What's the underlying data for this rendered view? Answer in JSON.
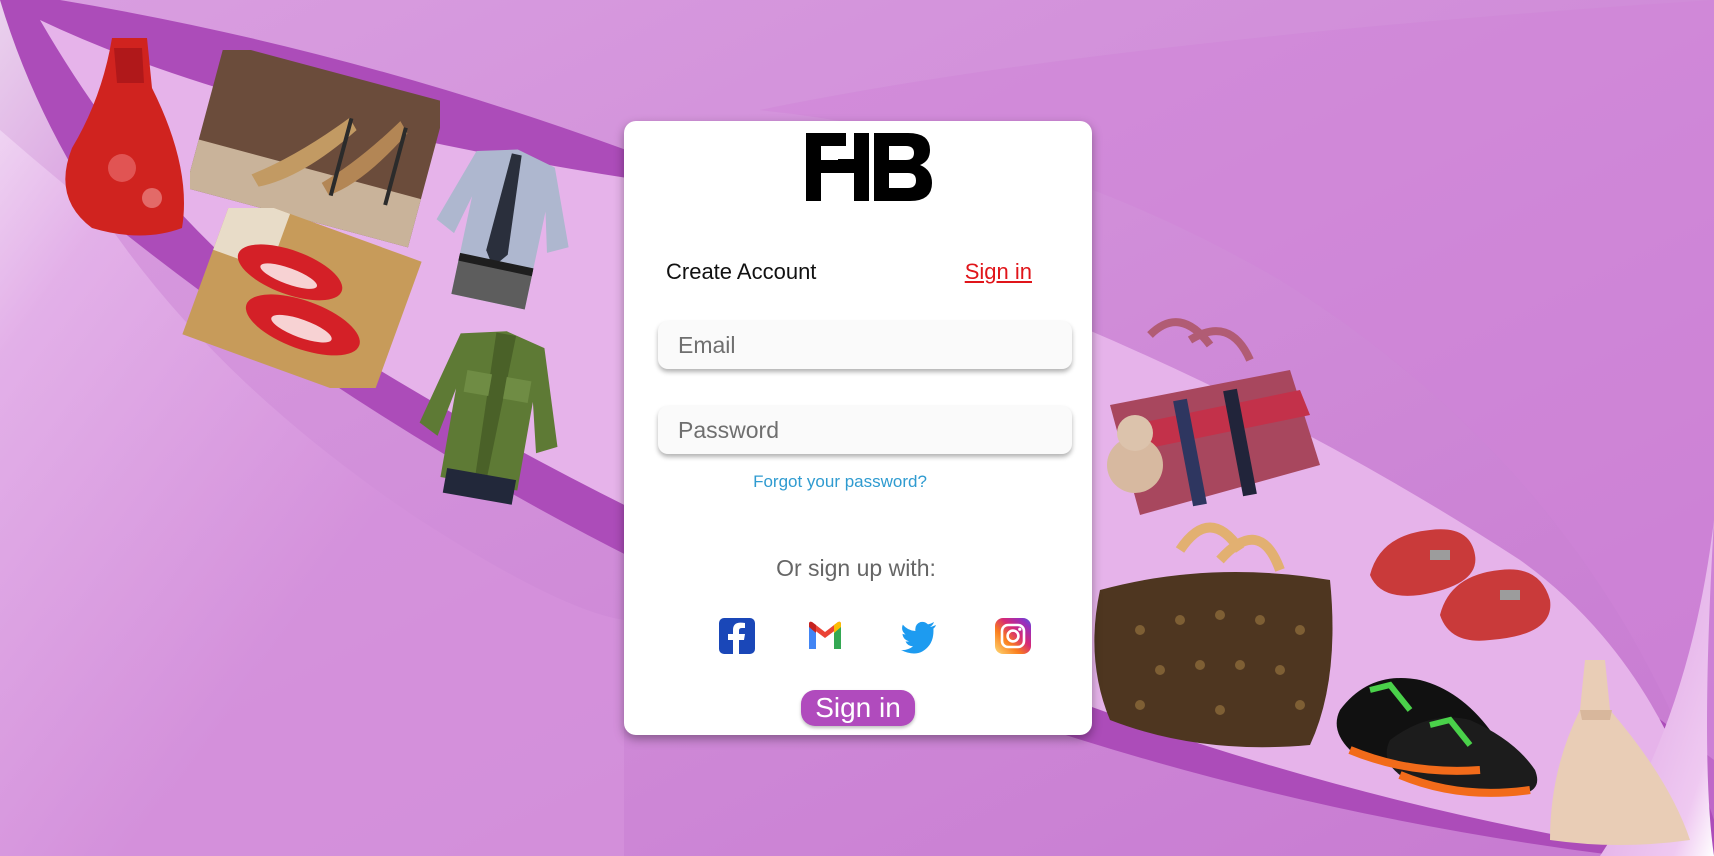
{
  "brand": {
    "logo_text": "FHB"
  },
  "tabs": {
    "create_account": "Create Account",
    "sign_in": "Sign in"
  },
  "form": {
    "email_placeholder": "Email",
    "password_placeholder": "Password",
    "forgot_password": "Forgot your password?",
    "or_sign_up": "Or sign up with:",
    "submit_label": "Sign in"
  },
  "social": [
    "facebook-icon",
    "gmail-icon",
    "twitter-icon",
    "instagram-icon"
  ],
  "colors": {
    "background": "#d28ad8",
    "band": "#ac4cb9",
    "accent_button": "#b04bbd",
    "sign_in_link": "#e0151a",
    "forgot_link": "#2f9bd0"
  }
}
